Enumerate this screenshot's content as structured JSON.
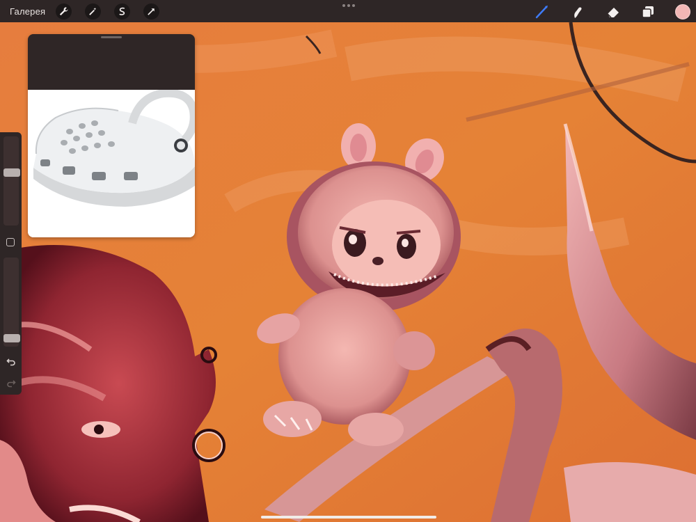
{
  "toolbar": {
    "gallery_label": "Галерея",
    "left_tools": [
      {
        "icon": "wrench-icon",
        "name": "actions"
      },
      {
        "icon": "magic-wand-icon",
        "name": "adjustments"
      },
      {
        "icon": "selection-s-icon",
        "name": "selection"
      },
      {
        "icon": "arrow-cursor-icon",
        "name": "transform"
      }
    ],
    "right_tools": [
      {
        "icon": "brush-icon",
        "name": "brush",
        "active": true
      },
      {
        "icon": "smudge-icon",
        "name": "smudge"
      },
      {
        "icon": "eraser-icon",
        "name": "eraser"
      },
      {
        "icon": "layers-icon",
        "name": "layers"
      }
    ],
    "current_color": "#f2b7b5",
    "accent_color": "#3e7bf7"
  },
  "sidebar": {
    "brush_size": 0.6,
    "brush_opacity": 0.05
  },
  "reference": {
    "title": "",
    "image_subject": "crocs-clog-icon"
  }
}
